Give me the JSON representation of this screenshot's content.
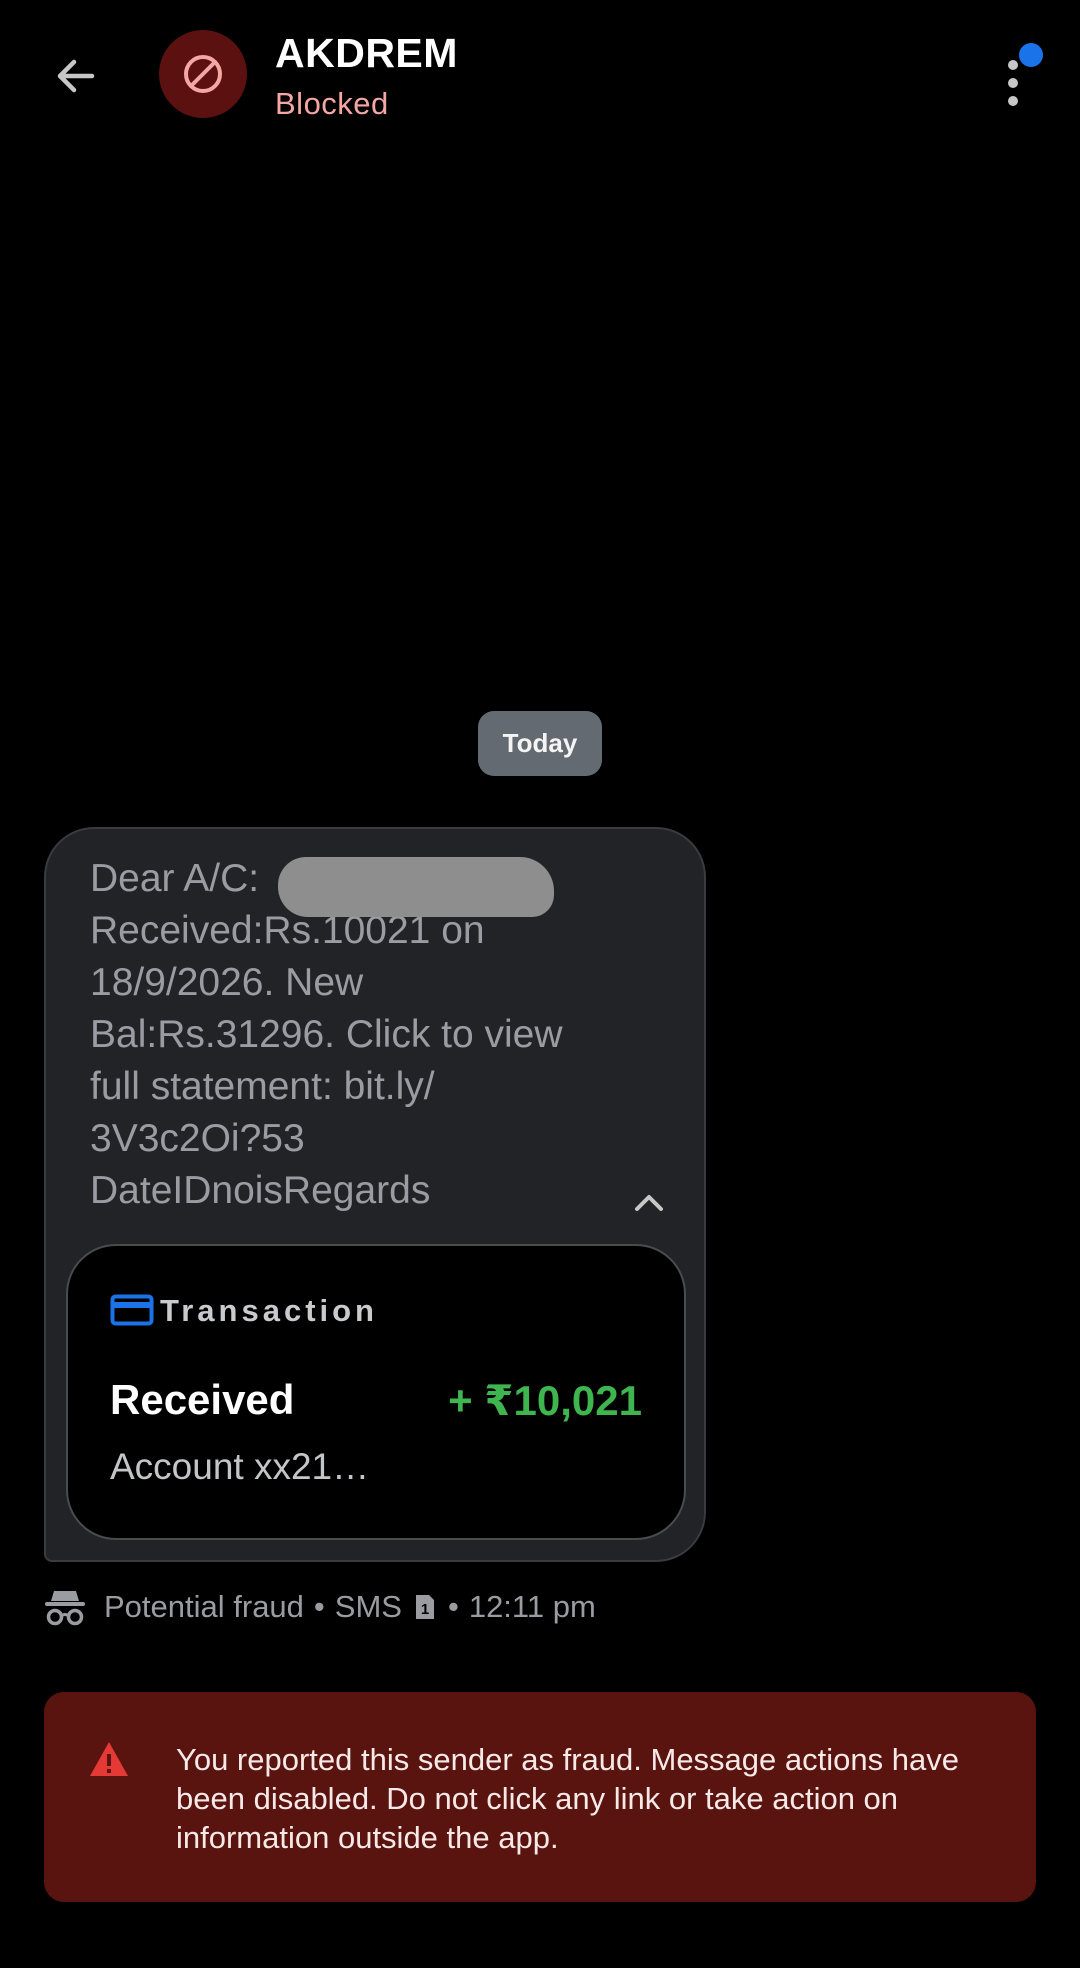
{
  "header": {
    "title": "AKDREM",
    "status": "Blocked"
  },
  "conversation": {
    "date_label": "Today",
    "message": {
      "text": "Dear A/C:\nReceived:Rs.10021 on\n18/9/2026. New\nBal:Rs.31296. Click to view\nfull statement: bit.ly/\n3V3c2Oi?53\nDateIDnoisRegards"
    },
    "transaction": {
      "header": "Transaction",
      "label": "Received",
      "amount": "+ ₹10,021",
      "account": "Account xx21…"
    },
    "meta": {
      "fraud_label": "Potential fraud",
      "channel": "SMS",
      "sim": "1",
      "time": "12:11 pm",
      "separator": "•"
    }
  },
  "warning": {
    "text": "You reported this sender as fraud. Message actions have been disabled. Do not click any link or take action on information outside the app."
  },
  "colors": {
    "avatar_bg": "#5c1111",
    "blocked_text": "#f4a7a4",
    "amount_green": "#3fb550",
    "warning_bg": "#5a1410",
    "warning_icon": "#e53935",
    "card_icon_blue": "#1a73e8",
    "notification_dot": "#1a73e8"
  },
  "icons": {
    "back": "arrow-back-icon",
    "avatar": "block-icon",
    "menu": "more-vert-icon",
    "collapse": "chevron-up-icon",
    "transaction": "credit-card-icon",
    "fraud": "spy-icon",
    "sim": "sim-card-icon",
    "warning": "warning-triangle-icon"
  }
}
